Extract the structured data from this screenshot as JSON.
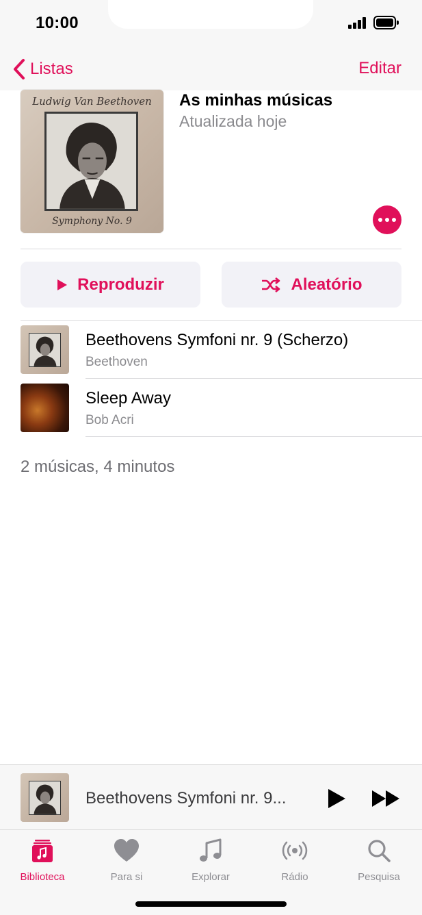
{
  "status_bar": {
    "time": "10:00"
  },
  "nav": {
    "back_label": "Listas",
    "edit_label": "Editar"
  },
  "playlist": {
    "title": "As minhas músicas",
    "subtitle": "Atualizada hoje",
    "artwork": {
      "top_text": "Ludwig Van Beethoven",
      "bottom_text": "Symphony No. 9"
    }
  },
  "actions": {
    "play_label": "Reproduzir",
    "shuffle_label": "Aleatório"
  },
  "tracks": [
    {
      "title": "Beethovens Symfoni nr. 9 (Scherzo)",
      "artist": "Beethoven"
    },
    {
      "title": "Sleep Away",
      "artist": "Bob Acri"
    }
  ],
  "summary": "2 músicas, 4 minutos",
  "now_playing": {
    "title": "Beethovens Symfoni nr. 9..."
  },
  "tabs": [
    {
      "label": "Biblioteca",
      "icon": "library-icon",
      "active": true
    },
    {
      "label": "Para si",
      "icon": "heart-icon",
      "active": false
    },
    {
      "label": "Explorar",
      "icon": "music-note-icon",
      "active": false
    },
    {
      "label": "Rádio",
      "icon": "radio-icon",
      "active": false
    },
    {
      "label": "Pesquisa",
      "icon": "search-icon",
      "active": false
    }
  ],
  "colors": {
    "accent": "#e0105a",
    "secondary_text": "#8a8a8e",
    "button_bg": "#f2f2f7"
  }
}
